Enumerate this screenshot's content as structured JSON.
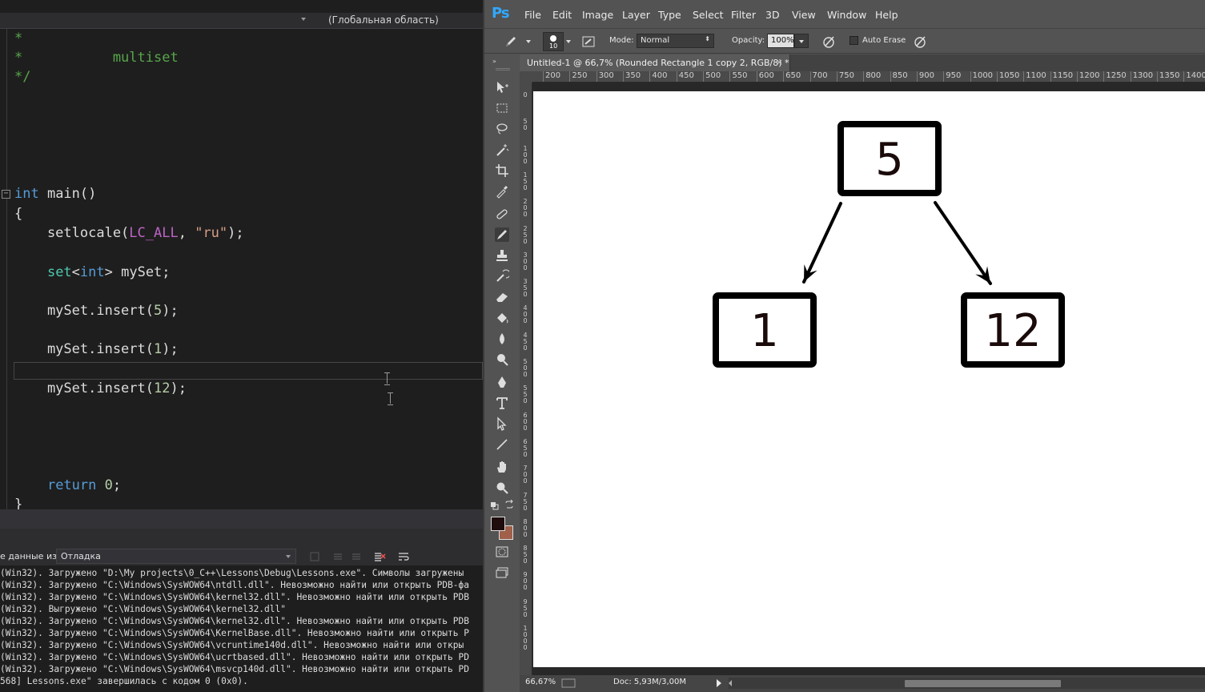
{
  "vs": {
    "navbar": {
      "scope": "(Глобальная область)"
    },
    "code_lines": [
      {
        "parts": [
          {
            "t": "*",
            "c": "cm"
          }
        ]
      },
      {
        "parts": [
          {
            "t": "*           multiset",
            "c": "cm"
          }
        ]
      },
      {
        "parts": [
          {
            "t": "*/",
            "c": "cm"
          }
        ]
      },
      {
        "parts": [
          {
            "t": "int",
            "c": "kw"
          },
          {
            "t": " main()",
            "c": ""
          }
        ]
      },
      {
        "parts": [
          {
            "t": "{",
            "c": ""
          }
        ]
      },
      {
        "parts": [
          {
            "t": "    setlocale(",
            "c": ""
          },
          {
            "t": "LC_ALL",
            "c": "mc"
          },
          {
            "t": ", ",
            "c": ""
          },
          {
            "t": "\"ru\"",
            "c": "st"
          },
          {
            "t": ");",
            "c": ""
          }
        ]
      },
      {
        "parts": [
          {
            "t": "    ",
            "c": ""
          },
          {
            "t": "set",
            "c": "ty"
          },
          {
            "t": "<",
            "c": ""
          },
          {
            "t": "int",
            "c": "kw"
          },
          {
            "t": "> mySet;",
            "c": ""
          }
        ]
      },
      {
        "parts": [
          {
            "t": "    mySet.insert(",
            "c": ""
          },
          {
            "t": "5",
            "c": "nu"
          },
          {
            "t": ");",
            "c": ""
          }
        ]
      },
      {
        "parts": [
          {
            "t": "    mySet.insert(",
            "c": ""
          },
          {
            "t": "1",
            "c": "nu"
          },
          {
            "t": ");",
            "c": ""
          }
        ]
      },
      {
        "parts": [
          {
            "t": "    mySet.insert(",
            "c": ""
          },
          {
            "t": "12",
            "c": "nu"
          },
          {
            "t": ");",
            "c": ""
          }
        ]
      },
      {
        "parts": [
          {
            "t": "    ",
            "c": ""
          },
          {
            "t": "return",
            "c": "kw"
          },
          {
            "t": " ",
            "c": ""
          },
          {
            "t": "0",
            "c": "nu"
          },
          {
            "t": ";",
            "c": ""
          }
        ]
      },
      {
        "parts": [
          {
            "t": "}",
            "c": ""
          }
        ]
      }
    ],
    "fold_glyph": "−",
    "output": {
      "label": "е данные из:",
      "source": "Отладка",
      "lines": [
        "(Win32). Загружено \"D:\\My projects\\0_C++\\Lessons\\Debug\\Lessons.exe\". Символы загружены",
        "(Win32). Загружено \"C:\\Windows\\SysWOW64\\ntdll.dll\". Невозможно найти или открыть PDB-фа",
        "(Win32). Загружено \"C:\\Windows\\SysWOW64\\kernel32.dll\". Невозможно найти или открыть PDB",
        "(Win32). Выгружено \"C:\\Windows\\SysWOW64\\kernel32.dll\"",
        "(Win32). Загружено \"C:\\Windows\\SysWOW64\\kernel32.dll\". Невозможно найти или открыть PDB",
        "(Win32). Загружено \"C:\\Windows\\SysWOW64\\KernelBase.dll\". Невозможно найти или открыть P",
        "(Win32). Загружено \"C:\\Windows\\SysWOW64\\vcruntime140d.dll\". Невозможно найти или откры",
        "(Win32). Загружено \"C:\\Windows\\SysWOW64\\ucrtbased.dll\". Невозможно найти или открыть PD",
        "(Win32). Загружено \"C:\\Windows\\SysWOW64\\msvcp140d.dll\". Невозможно найти или открыть PD",
        "568] Lessons.exe\" завершилась с кодом 0 (0x0)."
      ]
    }
  },
  "ps": {
    "logo": "Ps",
    "menu": [
      "File",
      "Edit",
      "Image",
      "Layer",
      "Type",
      "Select",
      "Filter",
      "3D",
      "View",
      "Window",
      "Help"
    ],
    "options": {
      "brush_size": "10",
      "mode_label": "Mode:",
      "mode_value": "Normal",
      "opacity_label": "Opacity:",
      "opacity_value": "100%",
      "auto_erase_label": "Auto Erase",
      "auto_erase_checked": false
    },
    "doc_tab": "Untitled-1 @ 66,7% (Rounded Rectangle 1 copy 2, RGB/8) *",
    "doc_tab_close": "×",
    "ruler_h": [
      "200",
      "250",
      "300",
      "350",
      "400",
      "450",
      "500",
      "550",
      "600",
      "650",
      "700",
      "750",
      "800",
      "850",
      "900",
      "950",
      "1000",
      "1050",
      "1100",
      "1150",
      "1200",
      "1250",
      "1300",
      "1350",
      "1400"
    ],
    "ruler_v": [
      "0",
      "50",
      "100",
      "150",
      "200",
      "250",
      "300",
      "350",
      "400",
      "450",
      "500",
      "550",
      "600",
      "650",
      "700",
      "750",
      "800",
      "850",
      "900",
      "950",
      "1000"
    ],
    "canvas": {
      "nodes": [
        {
          "id": "root",
          "label": "5"
        },
        {
          "id": "left",
          "label": "1"
        },
        {
          "id": "right",
          "label": "12"
        }
      ],
      "edges": [
        {
          "from": "root",
          "to": "left"
        },
        {
          "from": "root",
          "to": "right"
        }
      ],
      "ink_color": "#1a0a0a"
    },
    "status": {
      "zoom": "66,67%",
      "doc": "Doc: 5,93M/3,00M"
    },
    "fg_color": "#1f0c0c",
    "bg_color": "#a0604a"
  }
}
